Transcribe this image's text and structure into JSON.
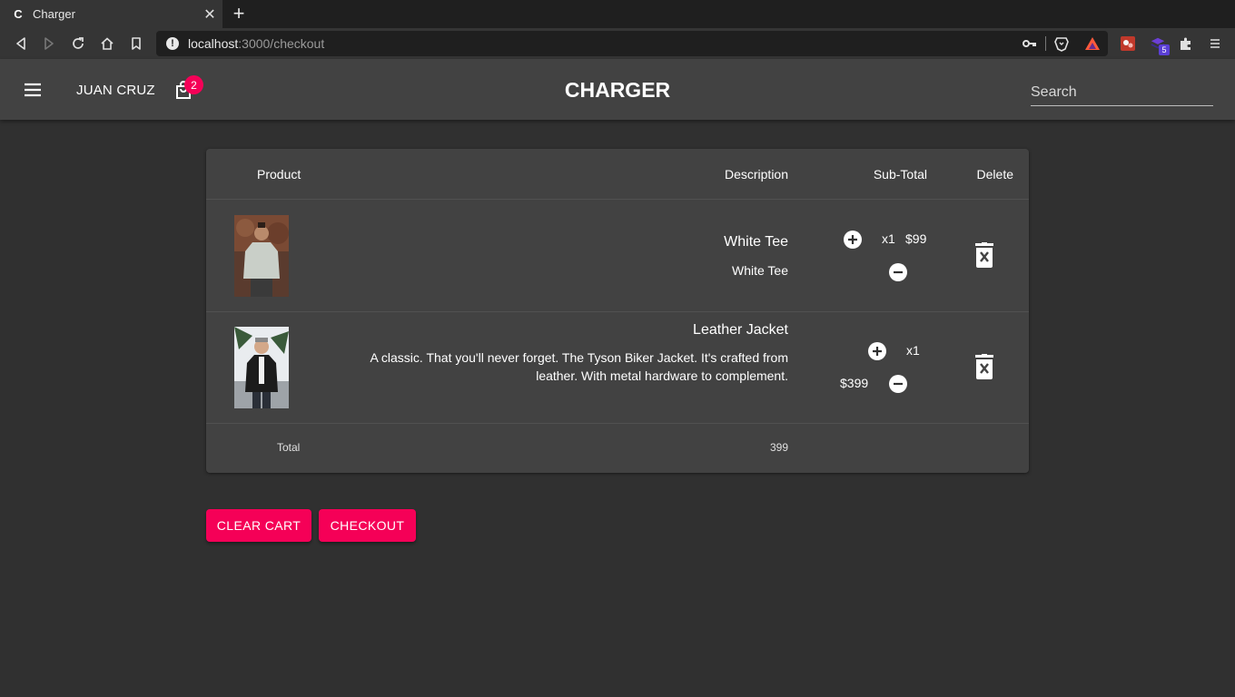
{
  "browser": {
    "tab_favicon": "C",
    "tab_title": "Charger",
    "url_host": "localhost",
    "url_path": ":3000/checkout",
    "extension_badge": "5"
  },
  "header": {
    "user_name": "JUAN CRUZ",
    "cart_count": "2",
    "brand": "CHARGER",
    "search_placeholder": "Search"
  },
  "table": {
    "headers": {
      "product": "Product",
      "description": "Description",
      "subtotal": "Sub-Total",
      "delete": "Delete"
    },
    "rows": [
      {
        "name": "White Tee",
        "description": "White Tee",
        "quantity": "x1",
        "price": "$99"
      },
      {
        "name": "Leather Jacket",
        "description": "A classic. That you'll never forget. The Tyson Biker Jacket. It's crafted from leather. With metal hardware to complement.",
        "quantity": "x1",
        "price": "$399"
      }
    ],
    "total_label": "Total",
    "total_value": "399"
  },
  "actions": {
    "clear_cart": "CLEAR CART",
    "checkout": "CHECKOUT"
  },
  "colors": {
    "accent": "#f50057",
    "background": "#303030",
    "surface": "#424242"
  }
}
